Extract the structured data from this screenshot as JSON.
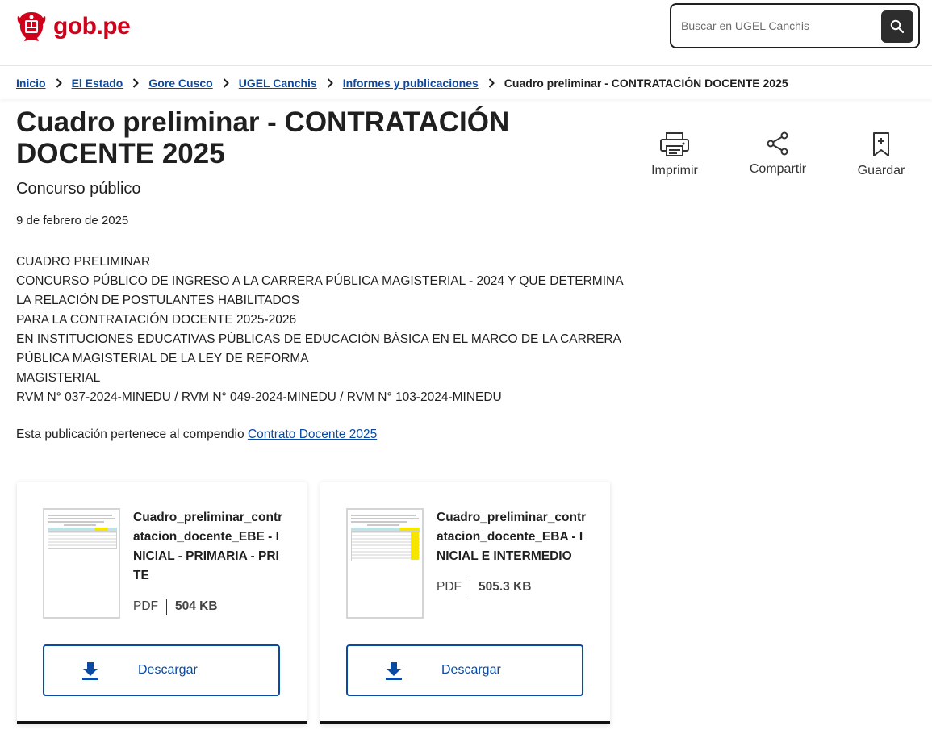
{
  "header": {
    "logo_text": "gob.pe",
    "search_placeholder": "Buscar en UGEL Canchis"
  },
  "breadcrumb": {
    "items": [
      "Inicio",
      "El Estado",
      "Gore Cusco",
      "UGEL Canchis",
      "Informes y publicaciones"
    ],
    "current": "Cuadro preliminar - CONTRATACIÓN DOCENTE 2025"
  },
  "page": {
    "title": "Cuadro preliminar - CONTRATACIÓN DOCENTE 2025",
    "subtitle": "Concurso público",
    "date": "9 de febrero de 2025"
  },
  "actions": {
    "print_label": "Imprimir",
    "share_label": "Compartir",
    "save_label": "Guardar"
  },
  "description": {
    "lines": [
      "CUADRO PRELIMINAR",
      "CONCURSO PÚBLICO DE INGRESO A LA CARRERA PÚBLICA MAGISTERIAL - 2024 Y QUE DETERMINA",
      "LA RELACIÓN DE POSTULANTES HABILITADOS",
      "PARA LA CONTRATACIÓN DOCENTE 2025-2026",
      "EN INSTITUCIONES EDUCATIVAS PÚBLICAS DE EDUCACIÓN BÁSICA EN EL MARCO DE LA CARRERA",
      "PÚBLICA MAGISTERIAL DE LA LEY DE REFORMA",
      "MAGISTERIAL",
      "RVM N° 037-2024-MINEDU / RVM N° 049-2024-MINEDU / RVM N° 103-2024-MINEDU"
    ]
  },
  "compendium": {
    "prefix": "Esta publicación pertenece al compendio",
    "link_text": "Contrato Docente 2025"
  },
  "files": [
    {
      "name": "Cuadro_preliminar_contratacion_docente_EBE - INICIAL - PRIMARIA - PRITE",
      "type": "PDF",
      "size": "504 KB",
      "download_label": "Descargar"
    },
    {
      "name": "Cuadro_preliminar_contratacion_docente_EBA - INICIAL E INTERMEDIO",
      "type": "PDF",
      "size": "505.3 KB",
      "download_label": "Descargar"
    }
  ],
  "colors": {
    "brand_red": "#d0021b",
    "link_blue": "#0b4aa2",
    "text_dark": "#1f1f1f"
  },
  "icons": {
    "search": "search-icon",
    "chevron": "chevron-right-icon",
    "print": "printer-icon",
    "share": "share-icon",
    "save": "bookmark-icon",
    "download": "download-icon"
  }
}
